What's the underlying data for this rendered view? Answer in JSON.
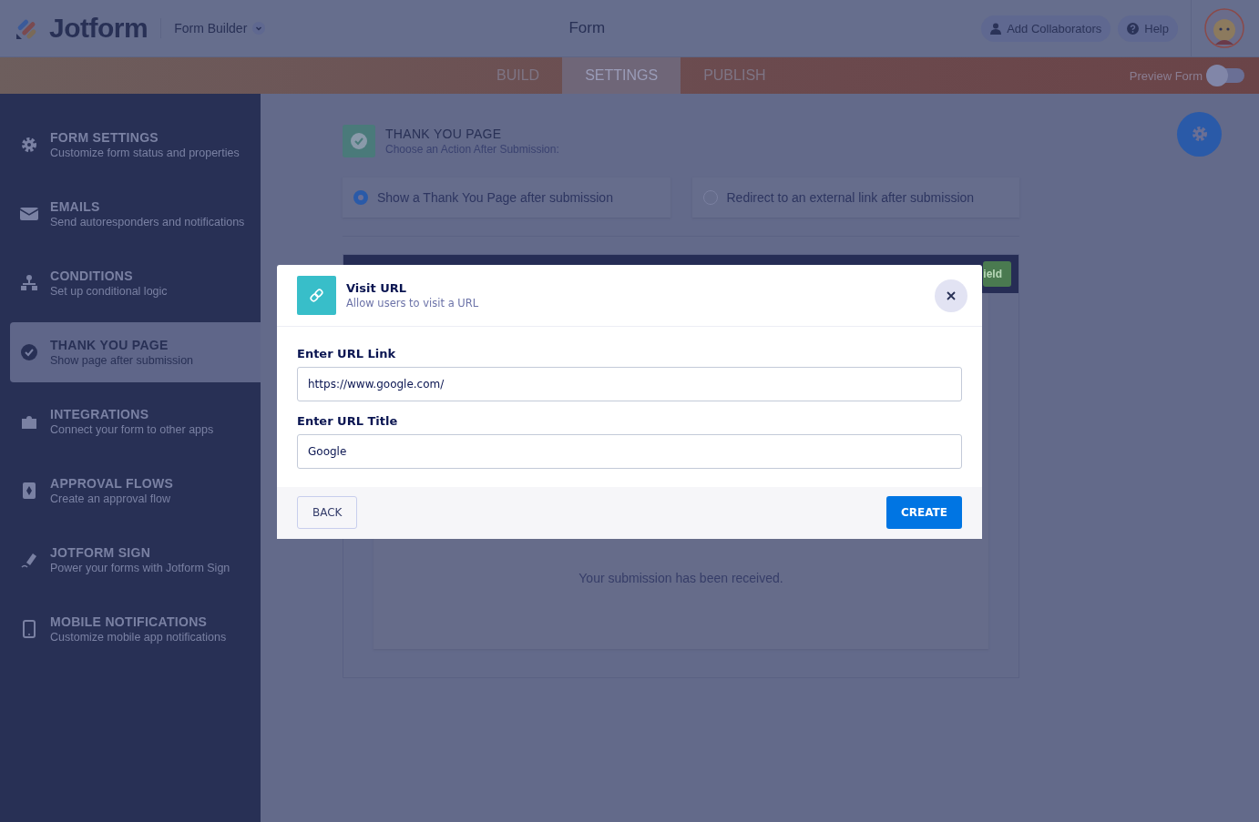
{
  "header": {
    "logo": "Jotform",
    "product": "Form Builder",
    "title": "Form",
    "buttons": [
      {
        "kind": "user",
        "label": "Add Collaborators"
      },
      {
        "kind": "help",
        "label": "Help"
      }
    ]
  },
  "tabs": [
    {
      "label": "BUILD",
      "selected": false
    },
    {
      "label": "SETTINGS",
      "selected": true
    },
    {
      "label": "PUBLISH",
      "selected": false
    }
  ],
  "preview": {
    "label": "Preview Form",
    "on": false
  },
  "sidebar": {
    "items": [
      {
        "title": "FORM SETTINGS",
        "subtitle": "Customize form status and properties",
        "selected": false
      },
      {
        "title": "EMAILS",
        "subtitle": "Send autoresponders and notifications",
        "selected": false
      },
      {
        "title": "CONDITIONS",
        "subtitle": "Set up conditional logic",
        "selected": false
      },
      {
        "title": "THANK YOU PAGE",
        "subtitle": "Show page after submission",
        "selected": true
      },
      {
        "title": "INTEGRATIONS",
        "subtitle": "Connect your form to other apps",
        "selected": false
      },
      {
        "title": "APPROVAL FLOWS",
        "subtitle": "Create an approval flow",
        "selected": false
      },
      {
        "title": "JOTFORM SIGN",
        "subtitle": "Power your forms with Jotform Sign",
        "selected": false
      },
      {
        "title": "MOBILE NOTIFICATIONS",
        "subtitle": "Customize mobile app notifications",
        "selected": false
      }
    ]
  },
  "section": {
    "title": "THANK YOU PAGE",
    "subtitle": "Choose an Action After Submission:",
    "options": [
      {
        "label": "Show a Thank You Page after submission",
        "selected": true
      },
      {
        "label": "Redirect to an external link after submission",
        "selected": false
      }
    ],
    "toolbar_button": "ield",
    "message": "Your submission has been received."
  },
  "modal": {
    "title": "Visit URL",
    "subtitle": "Allow users to visit a URL",
    "fields": [
      {
        "label": "Enter URL Link",
        "value": "https://www.google.com/"
      },
      {
        "label": "Enter URL Title",
        "value": "Google"
      }
    ],
    "back": "BACK",
    "create": "CREATE"
  }
}
